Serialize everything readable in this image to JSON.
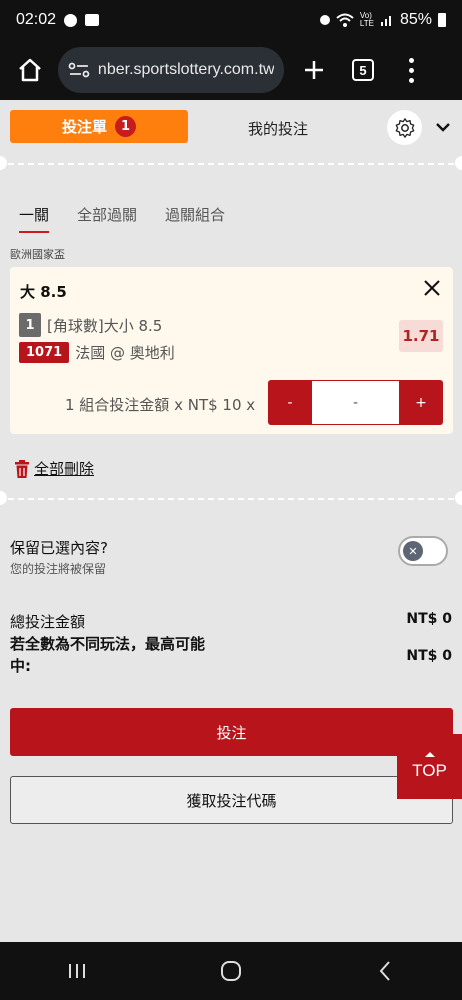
{
  "status_bar": {
    "time": "02:02",
    "battery": "85%",
    "icons": [
      "message-icon",
      "image-icon",
      "alarm-icon",
      "wifi-icon",
      "volte-icon",
      "signal-icon",
      "battery-icon"
    ]
  },
  "browser": {
    "url": "nber.sportslottery.com.tw",
    "tab_count": "5"
  },
  "betslip": {
    "tab_label": "投注單",
    "count": "1",
    "my_bets_label": "我的投注"
  },
  "subtabs": [
    "一關",
    "全部過關",
    "過關組合"
  ],
  "league": "歐洲國家盃",
  "bet": {
    "selection": "大 8.5",
    "market_index": "1",
    "market": "[角球數]大小 8.5",
    "match_code": "1071",
    "match": "法國 @ 奧地利",
    "odds": "1.71",
    "stake_label": "1 組合投注金額 x NT$ 10 x",
    "minus": "-",
    "stake_value": "-",
    "plus": "+"
  },
  "delete_all": "全部刪除",
  "keep": {
    "title": "保留已選內容?",
    "subtitle": "您的投注將被保留",
    "toggle_on": false
  },
  "totals": {
    "total_label": "總投注金額",
    "total_value": "NT$ 0",
    "max_win_label": "若全數為不同玩法，最高可能中:",
    "max_win_value": "NT$ 0"
  },
  "actions": {
    "place_bet": "投注",
    "get_code": "獲取投注代碼",
    "top": "TOP"
  },
  "colors": {
    "accent_orange": "#ff7f0e",
    "brand_red": "#b8141c",
    "odds_bg": "#f6dbd6",
    "card_bg": "#fff8ec"
  }
}
